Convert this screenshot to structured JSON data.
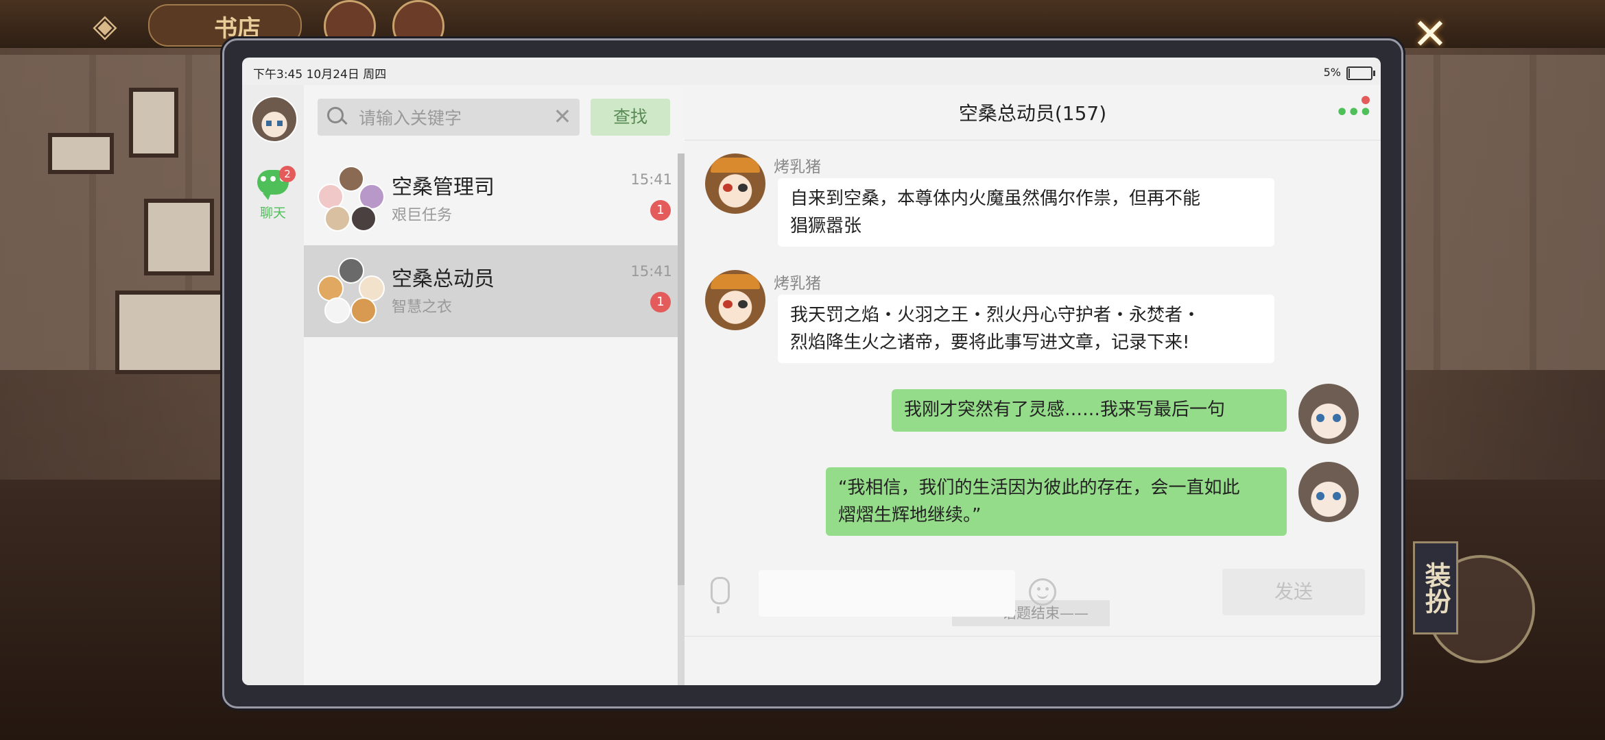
{
  "game": {
    "tab_label": "书店",
    "dress_label": "装扮"
  },
  "status": {
    "time": "下午3:45 10月24日 周四",
    "battery": "5%",
    "battery_fraction": 0.05
  },
  "nav": {
    "chat_label": "聊天",
    "chat_badge": "2"
  },
  "search": {
    "placeholder": "请输入关键字",
    "button": "查找"
  },
  "conversations": [
    {
      "name": "空桑管理司",
      "subtitle": "艰巨任务",
      "time": "15:41",
      "unread": "1",
      "selected": false
    },
    {
      "name": "空桑总动员",
      "subtitle": "智慧之衣",
      "time": "15:41",
      "unread": "1",
      "selected": true
    }
  ],
  "chat": {
    "title": "空桑总动员(157)",
    "messages": [
      {
        "sender": "烤乳猪",
        "side": "left",
        "lines": [
          "自来到空桑，本尊体内火魔虽然偶尔作祟，但再不能",
          "猖獗嚣张"
        ]
      },
      {
        "sender": "烤乳猪",
        "side": "left",
        "lines": [
          "我天罚之焰・火羽之王・烈火丹心守护者・永焚者・",
          "烈焰降生火之诸帝，要将此事写进文章，记录下来!"
        ]
      },
      {
        "sender": "",
        "side": "right",
        "lines": [
          "我刚才突然有了灵感……我来写最后一句"
        ]
      },
      {
        "sender": "",
        "side": "right",
        "lines": [
          "“我相信，我们的生活因为彼此的存在，会一直如此",
          "熠熠生辉地继续。”"
        ]
      }
    ],
    "divider": "——话题结束——",
    "input_value": "",
    "send_label": "发送"
  },
  "icons": {
    "back": "back-arrow-icon",
    "close": "close-icon",
    "search": "search-icon",
    "clear": "clear-icon",
    "more": "more-icon",
    "mic": "microphone-icon",
    "emoji": "emoji-icon",
    "chat": "chat-bubble-icon"
  },
  "colors": {
    "accent_green": "#4fbf5a",
    "bubble_green": "#95dc8a",
    "badge_red": "#e35b5b"
  }
}
